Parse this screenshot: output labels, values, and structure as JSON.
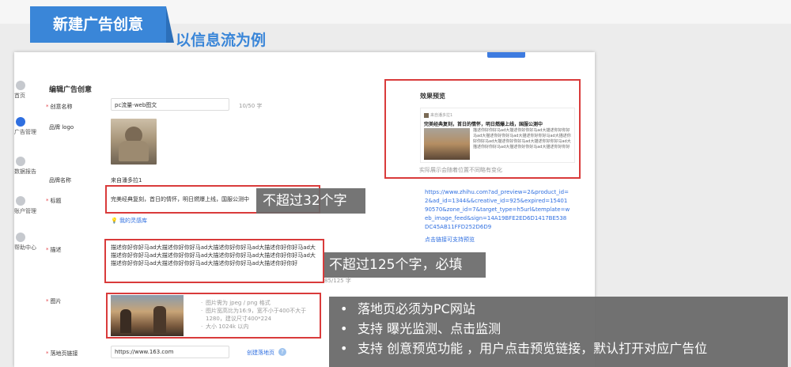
{
  "slide": {
    "title": "新建广告创意",
    "subtitle": "以信息流为例"
  },
  "nav": {
    "items": [
      {
        "label": "首页",
        "icon": "home-icon",
        "active": false
      },
      {
        "label": "广告管理",
        "icon": "ad-management-icon",
        "active": true
      },
      {
        "label": "数据报告",
        "icon": "report-icon",
        "active": false
      },
      {
        "label": "账户管理",
        "icon": "account-icon",
        "active": false
      },
      {
        "label": "帮助中心",
        "icon": "help-center-icon",
        "active": false
      }
    ]
  },
  "form": {
    "panel_title": "编辑广告创意",
    "creative_name": {
      "label": "创意名称",
      "value": "pc流量-web图文",
      "counter": "10/50 字"
    },
    "brand_logo": {
      "label": "品牌 logo"
    },
    "brand_name": {
      "label": "品牌名称",
      "value": "来自潘多拉1"
    },
    "title": {
      "label": "标题",
      "value": "完美经典复刻，首日的情怀，明日燃爆上线，国服公测中",
      "library_link": "我的灵感库"
    },
    "description": {
      "label": "描述",
      "value": "描述你好你好马ad大描述你好你好马ad大描述你好你好马ad大描述你好你好马ad大描述你好你好马ad大描述你好你好马ad大描述你好你好马ad大描述你好你好马ad大描述你好你好马ad大描述你好你好马ad大描述你好你好马ad大描述你好你好",
      "counter": "85/125 字"
    },
    "image": {
      "label": "图片",
      "tips": [
        "图片需为 jpeg / png 格式",
        "图片宽高比为16:9，宽不小于400不大于1280，建议尺寸400*224",
        "大小 1024k 以内"
      ]
    },
    "landing_page": {
      "label": "落地页链接",
      "value": "https://www.163.com",
      "create_link": "创建落地页",
      "help": "?"
    }
  },
  "preview": {
    "title": "效果预览",
    "brand": "来自潘多拉1",
    "card_title": "完美经典复刻，首日的情怀，明日燃爆上线，国服公测中",
    "card_desc": "描述你好你好马ad大描述你好你好马ad大描述你好你好马ad大描述你好你好马ad大描述你好你好马ad大描述你好你好马ad大描述你好你好马ad大描述你好你好马ad大描述你好你好马ad大描述你好你好马ad大描述你好你好",
    "note": "实际展示会随着位置不同略有变化",
    "url": "https://www.zhihu.com?ad_preview=2&product_id=2&ad_id=1344&&creative_id=925&expired=1540190570&zone_id=7&target_type=h5url&template=web_image_feed&sign=14A19BFE2ED6D1417BE538DC45AB11FFD252D6D9",
    "url_link": "点击链接可支持预览"
  },
  "annotations": {
    "title_limit": "不超过32个字",
    "desc_limit": "不超过125个字，必填",
    "notes": [
      "落地页必须为PC网站",
      "支持 曝光监测、点击监测",
      "支持 创意预览功能 ，用户点击预览链接，默认打开对应广告位"
    ]
  },
  "colors": {
    "accent": "#3a86d8",
    "highlight": "#d93b3b",
    "link": "#2f6fe0"
  }
}
